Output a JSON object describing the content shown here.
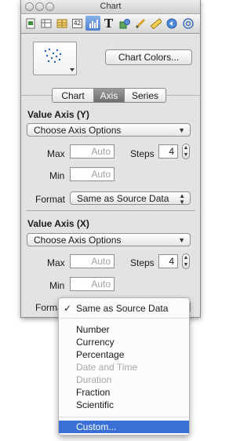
{
  "window": {
    "title": "Chart"
  },
  "toolbar": {
    "icons": [
      "document-icon",
      "grid-icon",
      "table-icon",
      "number-format-icon",
      "chart-icon",
      "text-icon",
      "shapes-icon",
      "pencil-icon",
      "ruler-icon",
      "navigation-icon",
      "at-icon"
    ],
    "number_label": "42",
    "text_label": "T"
  },
  "chart_colors_label": "Chart Colors...",
  "tabs": [
    "Chart",
    "Axis",
    "Series"
  ],
  "selected_tab": "Axis",
  "y_axis": {
    "title": "Value Axis (Y)",
    "options": "Choose Axis Options",
    "max_label": "Max",
    "max_placeholder": "Auto",
    "steps_label": "Steps",
    "steps_value": "4",
    "min_label": "Min",
    "min_placeholder": "Auto",
    "format_label": "Format",
    "format_value": "Same as Source Data"
  },
  "x_axis": {
    "title": "Value Axis (X)",
    "options": "Choose Axis Options",
    "max_label": "Max",
    "max_placeholder": "Auto",
    "steps_label": "Steps",
    "steps_value": "4",
    "min_label": "Min",
    "min_placeholder": "Auto",
    "format_label": "Forma"
  },
  "format_menu": {
    "checked": "Same as Source Data",
    "items": [
      {
        "label": "Number",
        "enabled": true
      },
      {
        "label": "Currency",
        "enabled": true
      },
      {
        "label": "Percentage",
        "enabled": true
      },
      {
        "label": "Date and Time",
        "enabled": false
      },
      {
        "label": "Duration",
        "enabled": false
      },
      {
        "label": "Fraction",
        "enabled": true
      },
      {
        "label": "Scientific",
        "enabled": true
      }
    ],
    "custom": "Custom...",
    "checkmark": "✓"
  },
  "colors": {
    "highlight": "#3a6fd6",
    "toolbar_selected": "#4a7fd0"
  }
}
